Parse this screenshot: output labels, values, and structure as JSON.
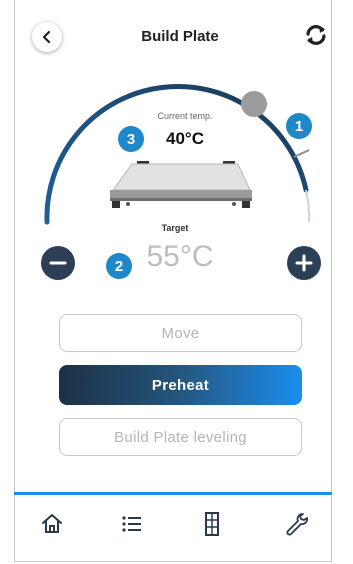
{
  "header": {
    "title": "Build Plate",
    "back_icon": "chevron-left-icon",
    "sync_icon": "sync-icon"
  },
  "dial": {
    "current_label": "Current temp.",
    "current_value": "40°C",
    "target_label": "Target",
    "target_value": "55°C",
    "decrease_icon": "minus-icon",
    "increase_icon": "plus-icon",
    "colors": {
      "arc": "#1d5f92",
      "accent": "#1e88c9",
      "button": "#2d3f55"
    }
  },
  "badges": [
    "1",
    "2",
    "3"
  ],
  "actions": {
    "move_label": "Move",
    "preheat_label": "Preheat",
    "leveling_label": "Build Plate leveling"
  },
  "nav": {
    "items": [
      {
        "icon": "home-icon"
      },
      {
        "icon": "list-icon"
      },
      {
        "icon": "storage-icon"
      },
      {
        "icon": "wrench-icon"
      }
    ]
  }
}
